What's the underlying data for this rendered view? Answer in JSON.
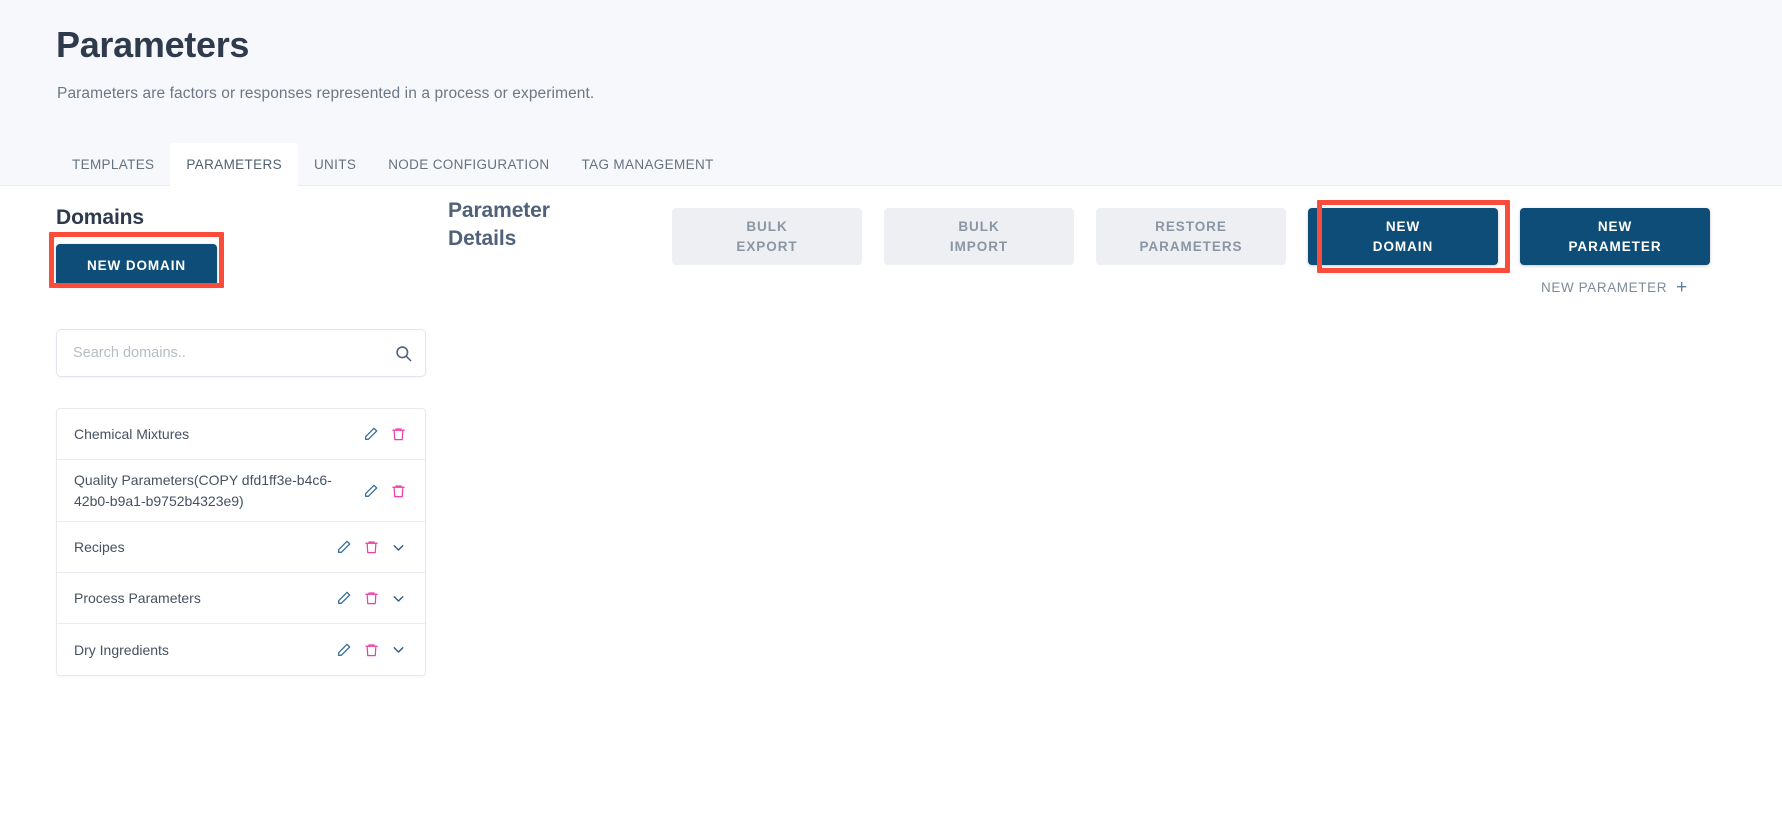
{
  "header": {
    "title": "Parameters",
    "subtitle": "Parameters are factors or responses represented in a process or experiment."
  },
  "tabs": [
    {
      "label": "TEMPLATES",
      "active": false
    },
    {
      "label": "PARAMETERS",
      "active": true
    },
    {
      "label": "UNITS",
      "active": false
    },
    {
      "label": "NODE CONFIGURATION",
      "active": false
    },
    {
      "label": "TAG MANAGEMENT",
      "active": false
    }
  ],
  "sidebar": {
    "heading": "Domains",
    "new_domain_label": "NEW DOMAIN",
    "search": {
      "placeholder": "Search domains..",
      "value": "",
      "icon": "search-icon"
    },
    "domains": [
      {
        "label": "Chemical Mixtures",
        "edit_icon": "pencil-icon",
        "delete_icon": "trash-icon",
        "has_expand": false
      },
      {
        "label": "Quality Parameters(COPY dfd1ff3e-b4c6-42b0-b9a1-b9752b4323e9)",
        "edit_icon": "pencil-icon",
        "delete_icon": "trash-icon",
        "has_expand": false
      },
      {
        "label": "Recipes",
        "edit_icon": "pencil-icon",
        "delete_icon": "trash-icon",
        "has_expand": true,
        "expand_icon": "chevron-down-icon"
      },
      {
        "label": "Process Parameters",
        "edit_icon": "pencil-icon",
        "delete_icon": "trash-icon",
        "has_expand": true,
        "expand_icon": "chevron-down-icon"
      },
      {
        "label": "Dry Ingredients",
        "edit_icon": "pencil-icon",
        "delete_icon": "trash-icon",
        "has_expand": true,
        "expand_icon": "chevron-down-icon"
      }
    ]
  },
  "details": {
    "title_line1": "Parameter",
    "title_line2": "Details",
    "toolbar": [
      {
        "line1": "BULK",
        "line2": "EXPORT",
        "style": "grey"
      },
      {
        "line1": "BULK",
        "line2": "IMPORT",
        "style": "grey"
      },
      {
        "line1": "RESTORE",
        "line2": "PARAMETERS",
        "style": "grey"
      },
      {
        "line1": "NEW",
        "line2": "DOMAIN",
        "style": "primary"
      },
      {
        "line1": "NEW",
        "line2": "PARAMETER",
        "style": "primary"
      }
    ],
    "new_parameter_link": "NEW PARAMETER",
    "new_parameter_plus": "+"
  },
  "colors": {
    "primary_button": "#0e4d78",
    "grey_button_bg": "#edeff3",
    "grey_button_text": "#8b96a4",
    "annotation_highlight": "#fb4b3b",
    "header_band_bg": "#f6f8fb",
    "pencil_icon": "#3d7099",
    "trash_icon": "#ef3fa6",
    "chevron_icon": "#2f5d85"
  }
}
